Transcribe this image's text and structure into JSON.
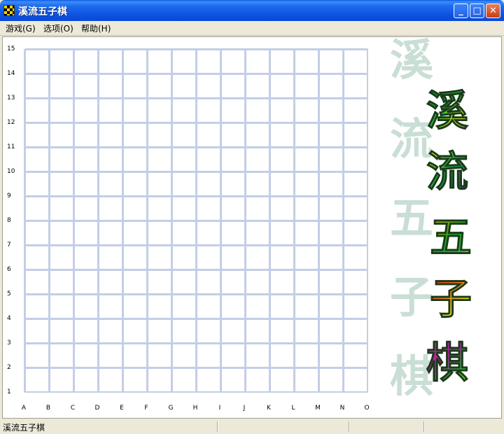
{
  "window": {
    "title": "溪流五子棋"
  },
  "titlebar": {
    "minimize": "_",
    "maximize": "□",
    "close": "✕"
  },
  "menu": [
    {
      "label": "游戏(G)"
    },
    {
      "label": "选项(O)"
    },
    {
      "label": "帮助(H)"
    }
  ],
  "board": {
    "size": 15,
    "row_labels": [
      "15",
      "14",
      "13",
      "12",
      "11",
      "10",
      "9",
      "8",
      "7",
      "6",
      "5",
      "4",
      "3",
      "2",
      "1"
    ],
    "col_labels": [
      "A",
      "B",
      "C",
      "D",
      "E",
      "F",
      "G",
      "H",
      "I",
      "J",
      "K",
      "L",
      "M",
      "N",
      "O"
    ],
    "grid_color": "#C3CEE6"
  },
  "logo": {
    "chars": [
      "溪",
      "流",
      "五",
      "子",
      "棋"
    ],
    "shadow_color": "#C9DED4"
  },
  "status": {
    "text": "溪流五子棋"
  }
}
